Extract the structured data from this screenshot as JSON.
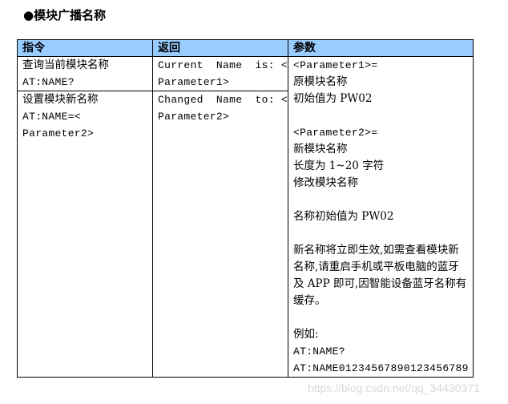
{
  "section": {
    "bullet": "●",
    "title": "模块广播名称"
  },
  "table": {
    "headers": [
      "指令",
      "返回",
      "参数"
    ],
    "header_color": "#99ccff",
    "rows": [
      {
        "command": [
          "查询当前模块名称",
          "AT:NAME?"
        ],
        "response": [
          "Current  Name  is: <",
          "Parameter1>"
        ]
      },
      {
        "command": [
          "设置模块新名称",
          "AT:NAME=<",
          "Parameter2>"
        ],
        "response": [
          "Changed  Name  to: <",
          "Parameter2>"
        ]
      }
    ],
    "parameters": {
      "p1_label": "<Parameter1>=",
      "p1_desc": "原模块名称",
      "p1_default": "初始值为 PW02",
      "p2_label": "<Parameter2>=",
      "p2_desc": "新模块名称",
      "p2_length": "长度为 1~20 字符",
      "p2_action": "修改模块名称",
      "default_name": "名称初始值为 PW02",
      "note": "新名称将立即生效,如需查看模块新名称,请重启手机或平板电脑的蓝牙及 APP 即可,因智能设备蓝牙名称有缓存。",
      "example_label": "例如:",
      "example_query": "AT:NAME?",
      "example_set": "AT:NAME01234567890123456789"
    }
  },
  "watermark": "https://blog.csdn.net/qq_34430371"
}
